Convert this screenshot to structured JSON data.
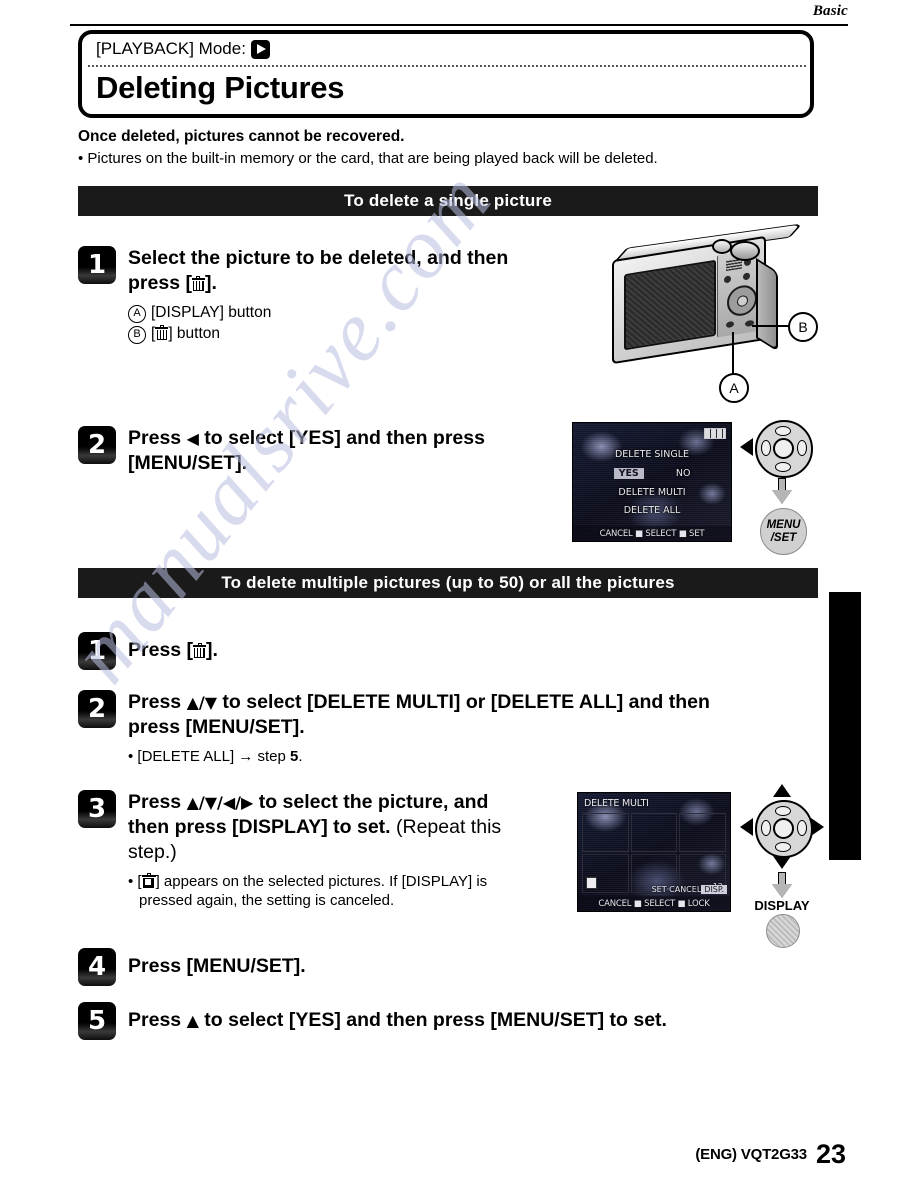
{
  "header": {
    "section_label": "Basic"
  },
  "title_box": {
    "mode_label": "[PLAYBACK] Mode:",
    "mode_icon": "playback-icon",
    "title": "Deleting Pictures"
  },
  "intro": {
    "warning": "Once deleted, pictures cannot be recovered.",
    "bullet": "• Pictures on the built-in memory or the card, that are being played back will be deleted."
  },
  "sections": [
    {
      "bar_label": "To delete a single picture",
      "steps": [
        {
          "number": "1",
          "title_parts": [
            "Select the picture to be deleted, and then",
            "press [",
            "]."
          ],
          "title_plain": "Select the picture to be deleted, and then press [trash].",
          "callouts": [
            {
              "mark": "A",
              "label": "[DISPLAY] button"
            },
            {
              "mark": "B",
              "label": "[trash] button"
            }
          ]
        },
        {
          "number": "2",
          "title_plain": "Press ◀ to select [YES] and then press [MENU/SET].",
          "line1_a": "Press ",
          "line1_arrow": "◀",
          "line1_b": " to select [YES] and then press",
          "line2": "[MENU/SET]."
        }
      ]
    },
    {
      "bar_label": "To delete multiple pictures (up to 50) or all the pictures",
      "steps": [
        {
          "number": "1",
          "title_plain": "Press [trash].",
          "pre": "Press [",
          "post": "]."
        },
        {
          "number": "2",
          "line1_a": "Press ",
          "line1_arrows": "▲/▼",
          "line1_b": " to select [DELETE MULTI] or [DELETE ALL] and then",
          "line2": "press [MENU/SET].",
          "note": "• [DELETE ALL] → step ",
          "note_bold": "5",
          "note_tail": "."
        },
        {
          "number": "3",
          "line1_a": "Press ",
          "line1_arrows": "▲/▼/◀/▶",
          "line1_b": " to select the picture, and",
          "line2_bold": "then press [DISPLAY] to set.",
          "line2_reg": " (Repeat this",
          "line3_reg": "step.)",
          "note_pre": "• [",
          "note_post": "] appears on the selected pictures. If [DISPLAY] is",
          "note_line2": "pressed again, the setting is canceled."
        },
        {
          "number": "4",
          "title_plain": "Press [MENU/SET]."
        },
        {
          "number": "5",
          "line1_a": "Press ",
          "line1_arrow": "▲",
          "line1_b": " to select [YES] and then press [MENU/SET] to set."
        }
      ]
    }
  ],
  "lcd_single": {
    "menu_title": "DELETE SINGLE",
    "option_yes": "YES",
    "option_no": "NO",
    "item_multi": "DELETE MULTI",
    "item_all": "DELETE ALL",
    "bottom_bar": "CANCEL ■ SELECT ■ SET"
  },
  "lcd_multi": {
    "menu_title": "DELETE MULTI",
    "thumbnails": [
      {
        "num": ""
      },
      {
        "num": ""
      },
      {
        "num": ""
      },
      {
        "num": ""
      },
      {
        "num": ""
      },
      {
        "num": "12"
      }
    ],
    "set_bar_label": "SET·CANCEL",
    "set_bar_key": "DISP.",
    "bottom_bar": "CANCEL ■ SELECT ■ LOCK"
  },
  "controls": {
    "step2": {
      "dial": "four-way-dial",
      "pressed_direction": "left",
      "button_line1": "MENU",
      "button_line2": "/SET"
    },
    "step3": {
      "dial": "four-way-dial",
      "pressed_direction": "all",
      "button_label": "DISPLAY"
    }
  },
  "camera_figure": {
    "callout_a": "A",
    "callout_b": "B"
  },
  "watermark": {
    "text": "manualsrive.com"
  },
  "footer": {
    "code": "(ENG) VQT2G33",
    "page_number": "23"
  }
}
